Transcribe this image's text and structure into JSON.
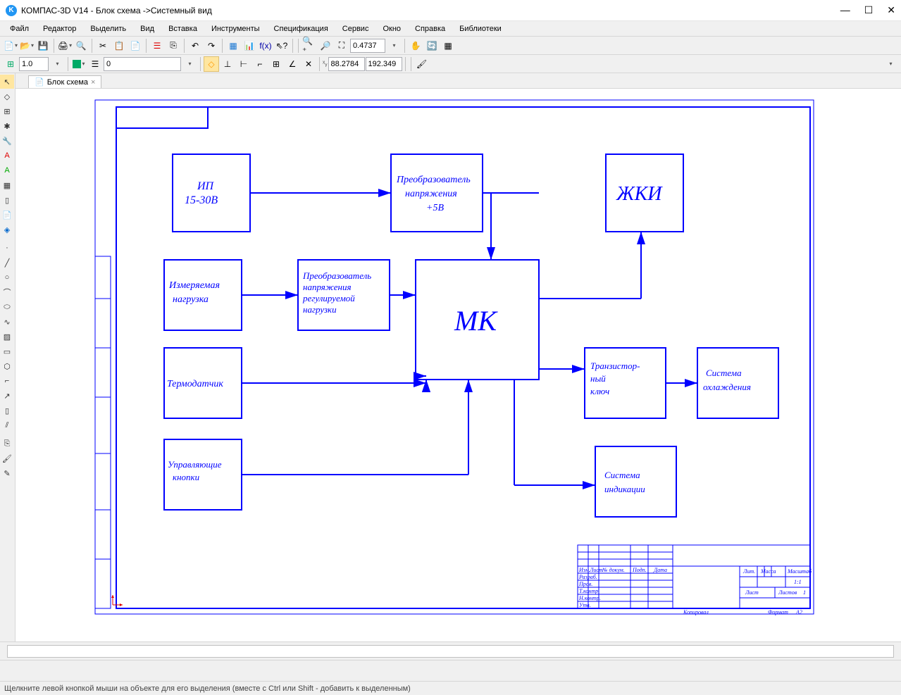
{
  "window": {
    "title": "КОМПАС-3D V14 - Блок схема ->Системный вид",
    "app_icon_letter": "K"
  },
  "menu": [
    "Файл",
    "Редактор",
    "Выделить",
    "Вид",
    "Вставка",
    "Инструменты",
    "Спецификация",
    "Сервис",
    "Окно",
    "Справка",
    "Библиотеки"
  ],
  "toolbar1": {
    "zoom_value": "0.4737"
  },
  "toolbar2": {
    "line_weight": "1.0",
    "layer": "0",
    "coord_x": "88.2784",
    "coord_y": "192.349"
  },
  "doc_tab": {
    "label": "Блок схема"
  },
  "diagram": {
    "blocks": {
      "b1_l1": "ИП",
      "b1_l2": "15-30В",
      "b2_l1": "Преобразователь",
      "b2_l2": "напряжения",
      "b2_l3": "+5В",
      "b3": "ЖКИ",
      "b4_l1": "Измеряемая",
      "b4_l2": "нагрузка",
      "b5_l1": "Преобразователь",
      "b5_l2": "напряжения",
      "b5_l3": "регулируемой",
      "b5_l4": "нагрузки",
      "b6": "МК",
      "b7": "Термодатчик",
      "b8_l1": "Транзистор-",
      "b8_l2": "ный",
      "b8_l3": "ключ",
      "b9_l1": "Система",
      "b9_l2": "охлаждения",
      "b10_l1": "Управляющие",
      "b10_l2": "кнопки",
      "b11_l1": "Система",
      "b11_l2": "индикации"
    },
    "titleblock": {
      "h1": "Изм.",
      "h2": "Лист",
      "h3": "№ докум.",
      "h4": "Подп.",
      "h5": "Дата",
      "r1": "Разраб.",
      "r2": "Пров.",
      "r3": "Т.контр.",
      "r4": "Н.контр.",
      "r5": "Утв.",
      "lit": "Лит.",
      "mass": "Масса",
      "scale": "Масштаб",
      "scale_val": "1:1",
      "list": "Лист",
      "listov": "Листов",
      "listov_val": "1",
      "kopi": "Копировал",
      "format": "Формат",
      "format_val": "А2"
    }
  },
  "statusbar": {
    "text": "Щелкните левой кнопкой мыши на объекте для его выделения (вместе с Ctrl или Shift - добавить к выделенным)"
  }
}
